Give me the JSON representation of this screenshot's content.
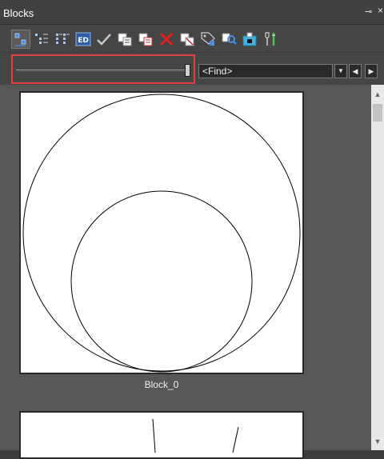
{
  "window": {
    "title": "Blocks",
    "pin_icon": "pin-icon",
    "close_icon": "close-icon"
  },
  "toolbar": {
    "buttons": [
      {
        "name": "thumbnail-view-icon",
        "active": true
      },
      {
        "name": "tree-view-icon"
      },
      {
        "name": "list-view-icon"
      },
      {
        "name": "block-editor-icon",
        "text": "ED"
      },
      {
        "name": "checkmark-icon"
      },
      {
        "name": "copy-block-icon"
      },
      {
        "name": "paste-block-icon"
      },
      {
        "name": "delete-icon"
      },
      {
        "name": "rename-block-icon"
      },
      {
        "name": "tag-icon"
      },
      {
        "name": "find-block-icon"
      },
      {
        "name": "insert-block-icon"
      },
      {
        "name": "settings-icon"
      }
    ]
  },
  "find": {
    "value": "<Find>"
  },
  "blocks": [
    {
      "label": "Block_0"
    }
  ],
  "colors": {
    "background": "#3c3c3c",
    "panel": "#575757",
    "highlight": "#e04040"
  }
}
